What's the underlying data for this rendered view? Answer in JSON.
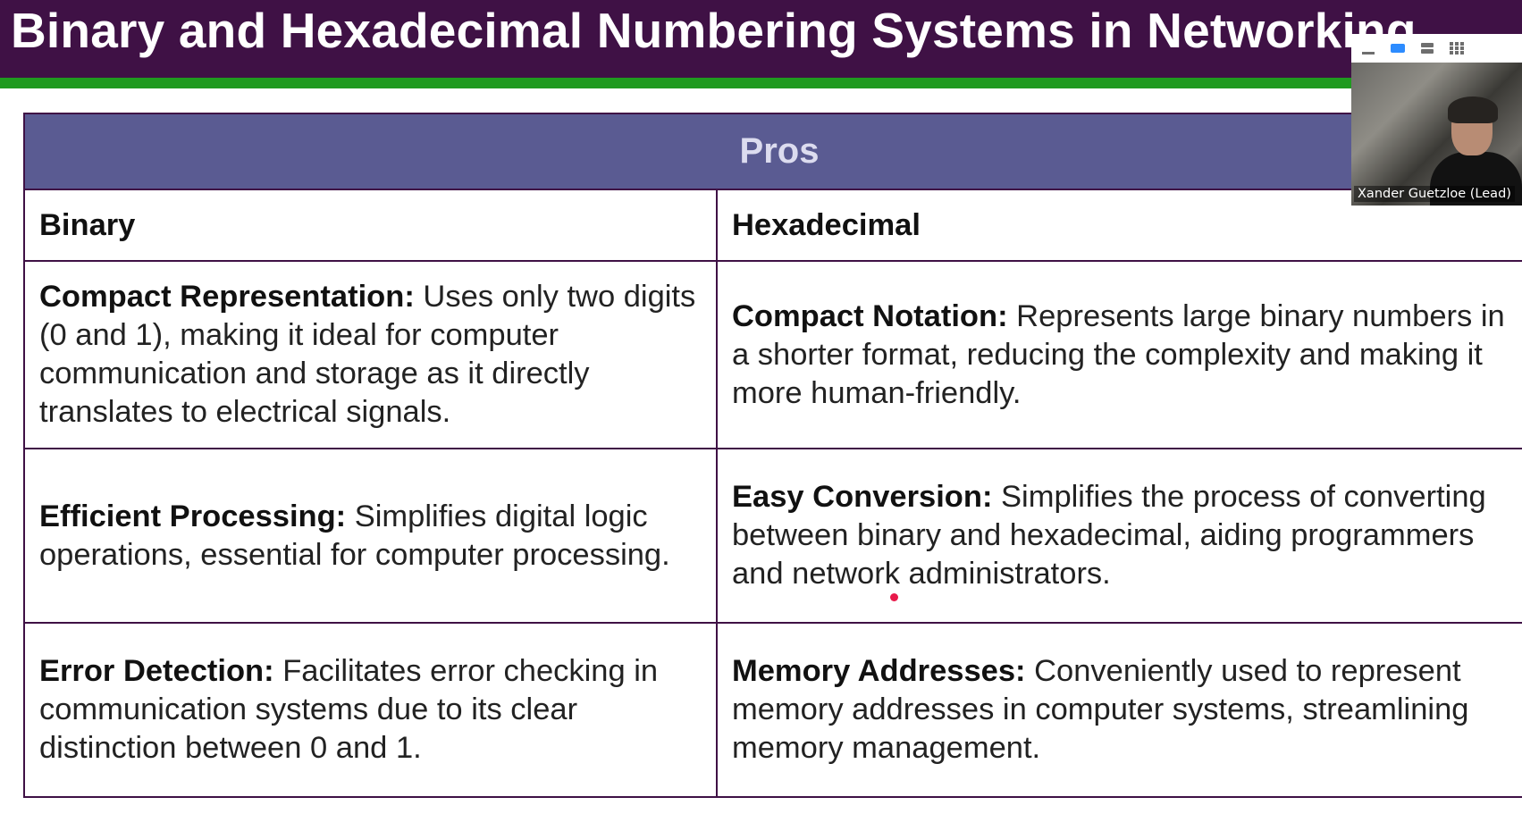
{
  "slide": {
    "title": "Binary and Hexadecimal Numbering Systems in Networking"
  },
  "table": {
    "header": "Pros",
    "columns": [
      "Binary",
      "Hexadecimal"
    ],
    "rows": [
      {
        "binary": {
          "term": "Compact Representation:",
          "text": " Uses only two digits (0 and 1), making it ideal for computer communication and storage as it directly translates to electrical signals."
        },
        "hex": {
          "term": "Compact Notation:",
          "text": " Represents large binary numbers in a shorter format, reducing the complexity and making it more human-friendly."
        }
      },
      {
        "binary": {
          "term": "Efficient Processing:",
          "text": " Simplifies digital logic operations, essential for computer processing."
        },
        "hex": {
          "term": "Easy Conversion:",
          "text": " Simplifies the process of converting between binary and hexadecimal, aiding programmers and network administrators."
        }
      },
      {
        "binary": {
          "term": "Error Detection:",
          "text": " Facilitates error checking in communication systems due to its clear distinction between 0 and 1."
        },
        "hex": {
          "term": "Memory Addresses:",
          "text": " Conveniently used to represent memory addresses in computer systems, streamlining memory management."
        }
      }
    ]
  },
  "video": {
    "participant_name": "Xander Guetzloe (Lead)",
    "controls": [
      "minimize-icon",
      "speaker-view-icon",
      "list-view-icon",
      "grid-view-icon"
    ]
  },
  "colors": {
    "title_bg": "#3f1145",
    "accent_green": "#1f9a1f",
    "table_header_bg": "#5a5b92",
    "border": "#3f1145",
    "cursor": "#e8194a",
    "active_control": "#2d8cff"
  }
}
